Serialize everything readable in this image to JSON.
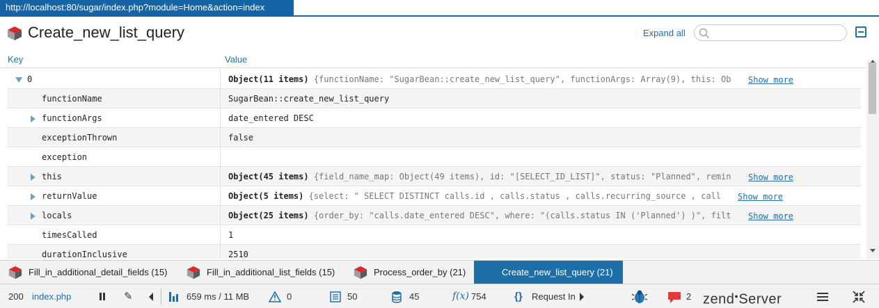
{
  "url": "http://localhost:80/sugar/index.php?module=Home&action=index",
  "header": {
    "title": "Create_new_list_query",
    "expand_all": "Expand all",
    "search_placeholder": ""
  },
  "columns": {
    "key": "Key",
    "value": "Value"
  },
  "rows": [
    {
      "key": "0",
      "expandable": true,
      "expanded": true,
      "level": 0,
      "value_bold": "Object(11 items)",
      "value_preview": "{functionName: \"SugarBean::create_new_list_query\", functionArgs: Array(9), this: Ob",
      "show_more": "Show more"
    },
    {
      "key": "functionName",
      "expandable": false,
      "level": 1,
      "value_plain": "SugarBean::create_new_list_query"
    },
    {
      "key": "functionArgs",
      "expandable": true,
      "expanded": false,
      "level": 1,
      "value_plain": "date_entered DESC"
    },
    {
      "key": "exceptionThrown",
      "expandable": false,
      "level": 1,
      "value_plain": "false"
    },
    {
      "key": "exception",
      "expandable": false,
      "level": 1,
      "value_plain": ""
    },
    {
      "key": "this",
      "expandable": true,
      "expanded": false,
      "level": 1,
      "value_bold": "Object(45 items)",
      "value_preview": "{field_name_map: Object(49 items), id: \"[SELECT_ID_LIST]\", status: \"Planned\", remin",
      "show_more": "Show more"
    },
    {
      "key": "returnValue",
      "expandable": true,
      "expanded": false,
      "level": 1,
      "value_bold": "Object(5 items)",
      "value_preview": "{select: \" SELECT DISTINCT calls.id , calls.status , calls.recurring_source , call",
      "show_more": "Show more"
    },
    {
      "key": "locals",
      "expandable": true,
      "expanded": false,
      "level": 1,
      "value_bold": "Object(25 items)",
      "value_preview": "{order_by: \"calls.date_entered DESC\", where: \"(calls.status IN ('Planned') )\", filt",
      "show_more": "Show more"
    },
    {
      "key": "timesCalled",
      "expandable": false,
      "level": 1,
      "value_plain": "1"
    },
    {
      "key": "durationInclusive",
      "expandable": false,
      "level": 1,
      "value_plain": "2510"
    }
  ],
  "tabs": [
    {
      "label": "Fill_in_additional_detail_fields (15)",
      "active": false
    },
    {
      "label": "Fill_in_additional_list_fields (15)",
      "active": false
    },
    {
      "label": "Process_order_by (21)",
      "active": false
    },
    {
      "label": "Create_new_list_query (21)",
      "active": true
    }
  ],
  "statusbar": {
    "status_code": "200",
    "page": "index.php",
    "timing": "659 ms / 11 MB",
    "warnings": "0",
    "logs": "50",
    "queries": "45",
    "functions": "754",
    "request": "Request In",
    "notifications": "2",
    "logo_main": "zend",
    "logo_sub": "Server"
  },
  "colors": {
    "accent": "#1e6fa8",
    "url_bar": "#1565a6",
    "alt_row": "#f4f4f4"
  }
}
